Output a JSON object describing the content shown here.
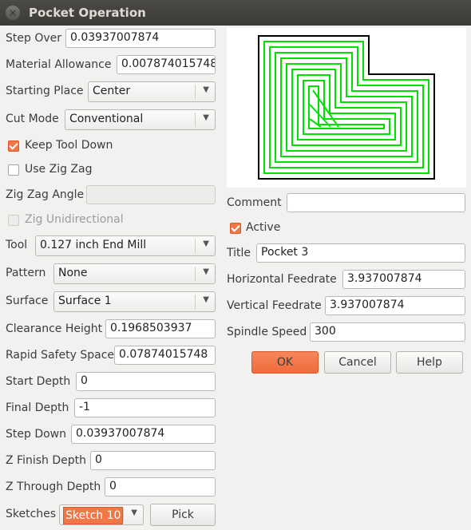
{
  "window": {
    "title": "Pocket Operation"
  },
  "left": {
    "step_over": {
      "label": "Step Over",
      "value": "0.03937007874"
    },
    "material_allowance": {
      "label": "Material Allowance",
      "value": "0.007874015748"
    },
    "starting_place": {
      "label": "Starting Place",
      "value": "Center"
    },
    "cut_mode": {
      "label": "Cut Mode",
      "value": "Conventional"
    },
    "keep_tool_down": {
      "label": "Keep Tool Down",
      "checked": true
    },
    "use_zig_zag": {
      "label": "Use Zig Zag",
      "checked": false
    },
    "zig_zag_angle": {
      "label": "Zig Zag Angle",
      "value": ""
    },
    "zig_unidirectional": {
      "label": "Zig Unidirectional",
      "checked": false
    },
    "tool": {
      "label": "Tool",
      "value": "0.127 inch End Mill"
    },
    "pattern": {
      "label": "Pattern",
      "value": "None"
    },
    "surface": {
      "label": "Surface",
      "value": "Surface 1"
    },
    "clearance_height": {
      "label": "Clearance Height",
      "value": "0.1968503937"
    },
    "rapid_safety_space": {
      "label": "Rapid Safety Space",
      "value": "0.07874015748"
    },
    "start_depth": {
      "label": "Start Depth",
      "value": "0"
    },
    "final_depth": {
      "label": "Final Depth",
      "value": "-1"
    },
    "step_down": {
      "label": "Step Down",
      "value": "0.03937007874"
    },
    "z_finish_depth": {
      "label": "Z Finish Depth",
      "value": "0"
    },
    "z_through_depth": {
      "label": "Z Through Depth",
      "value": "0"
    },
    "sketches": {
      "label": "Sketches",
      "value": "Sketch 10",
      "pick_label": "Pick"
    }
  },
  "right": {
    "comment": {
      "label": "Comment",
      "value": ""
    },
    "active": {
      "label": "Active",
      "checked": true
    },
    "title": {
      "label": "Title",
      "value": "Pocket 3"
    },
    "horizontal_feedrate": {
      "label": "Horizontal Feedrate",
      "value": "3.937007874"
    },
    "vertical_feedrate": {
      "label": "Vertical Feedrate",
      "value": "3.937007874"
    },
    "spindle_speed": {
      "label": "Spindle Speed",
      "value": "300"
    },
    "buttons": {
      "ok": "OK",
      "cancel": "Cancel",
      "help": "Help"
    }
  },
  "colors": {
    "accent": "#f07746",
    "toolpath": "#00e000",
    "boundary": "#000000",
    "titlebar": "#3c3b37"
  },
  "icons": {
    "close": "close-icon",
    "dropdown": "chevron-down-icon"
  }
}
